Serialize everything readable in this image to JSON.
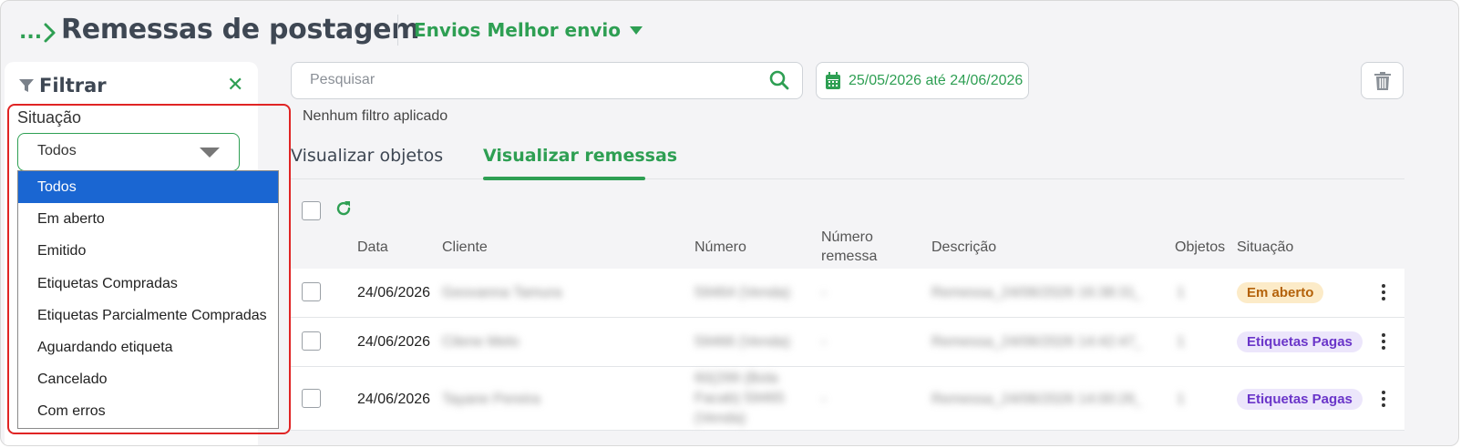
{
  "header": {
    "breadcrumb_dots": "...",
    "title": "Remessas de postagem",
    "envios_label": "Envios Melhor envio"
  },
  "filter": {
    "title": "Filtrar",
    "close": "✕",
    "situacao_label": "Situação",
    "selected": "Todos",
    "options": [
      "Todos",
      "Em aberto",
      "Emitido",
      "Etiquetas Compradas",
      "Etiquetas Parcialmente Compradas",
      "Aguardando etiqueta",
      "Cancelado",
      "Com erros"
    ]
  },
  "toolbar": {
    "search_placeholder": "Pesquisar",
    "date_range": "25/05/2026 até 24/06/2026",
    "no_filter": "Nenhum filtro aplicado"
  },
  "tabs": [
    {
      "label": "Visualizar objetos",
      "active": false
    },
    {
      "label": "Visualizar remessas",
      "active": true
    }
  ],
  "table": {
    "headers": {
      "data": "Data",
      "cliente": "Cliente",
      "numero": "Número",
      "numero_remessa": "Número remessa",
      "descricao": "Descrição",
      "objetos": "Objetos",
      "situacao": "Situação"
    },
    "rows": [
      {
        "data": "24/06/2026",
        "cliente": "Geovanna Tamura",
        "numero": "59464 (Venda)",
        "numero_remessa": "-",
        "descricao": "Remessa_24/06/2026 16:38:31_1",
        "objetos": "1",
        "situacao": "Em aberto",
        "situacao_kind": "aberto"
      },
      {
        "data": "24/06/2026",
        "cliente": "Cilene Melo",
        "numero": "59466 (Venda)",
        "numero_remessa": "-",
        "descricao": "Remessa_24/06/2026 14:42:47_1",
        "objetos": "1",
        "situacao": "Etiquetas Pagas",
        "situacao_kind": "pagas"
      },
      {
        "data": "24/06/2026",
        "cliente": "Tayane Pereira",
        "numero": "60(299 (Bola Facab) 59465 (Venda)",
        "numero_remessa": "-",
        "descricao": "Remessa_24/06/2026 14:00:26_1",
        "objetos": "1",
        "situacao": "Etiquetas Pagas",
        "situacao_kind": "pagas"
      }
    ]
  },
  "colors": {
    "brand_green": "#2e9f53",
    "selected_blue": "#1a66d2",
    "highlight_red": "#e02424"
  }
}
